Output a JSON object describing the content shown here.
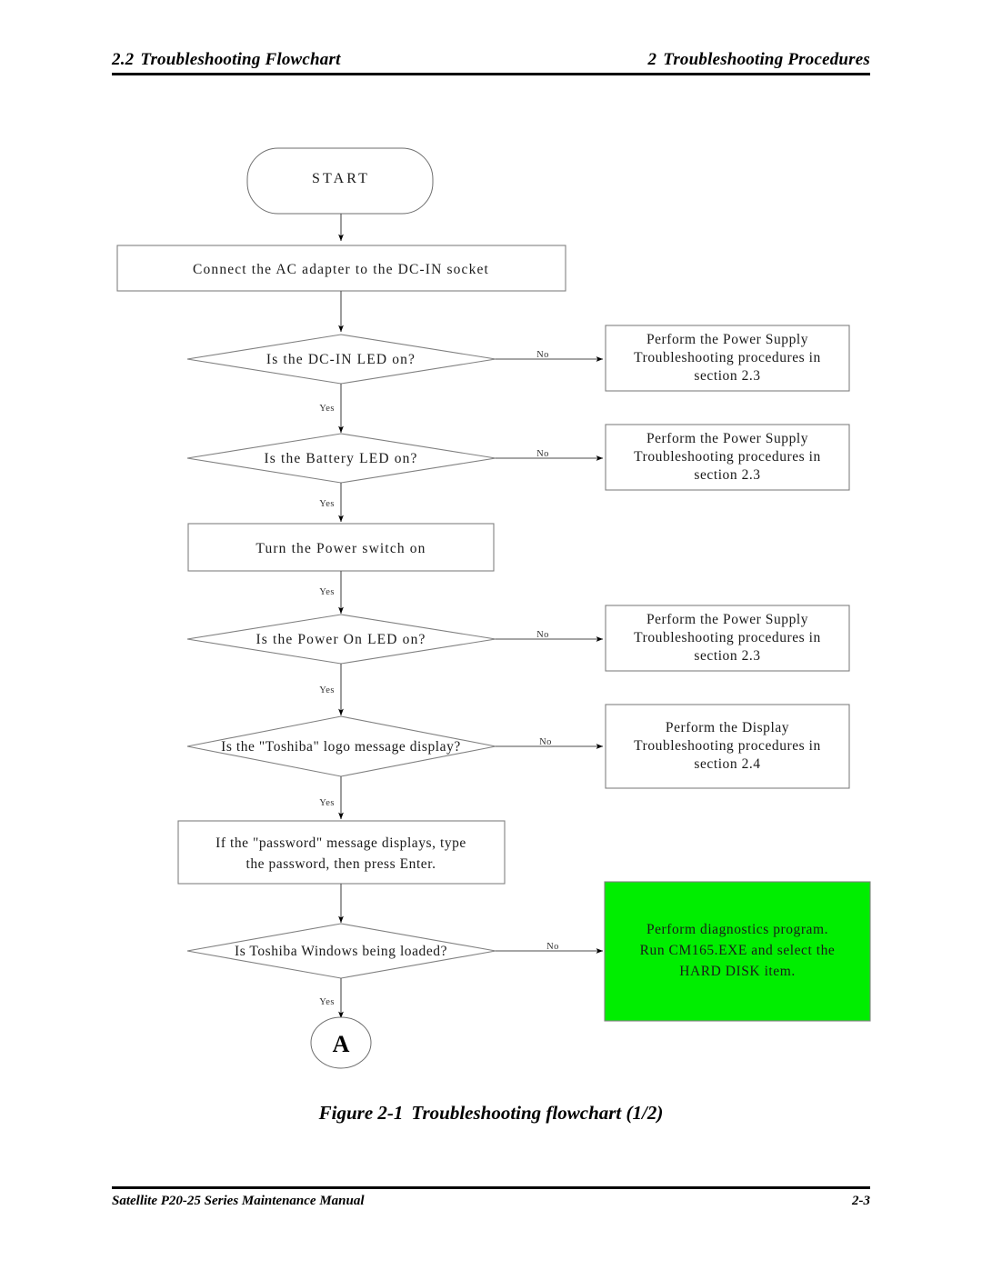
{
  "header": {
    "left_number": "2.2",
    "left_title": "Troubleshooting Flowchart",
    "right_number": "2",
    "right_title": "Troubleshooting Procedures"
  },
  "footer": {
    "manual_title": "Satellite P20-25 Series Maintenance Manual",
    "page_number": "2-3"
  },
  "caption": {
    "label": "Figure 2-1",
    "text": "Troubleshooting flowchart (1/2)"
  },
  "colors": {
    "highlight_green": "#00ee00",
    "shape_border": "#808080",
    "connector": "#4d4d4d",
    "text": "#1a1a1a"
  },
  "flowchart": {
    "branch_yes": "Yes",
    "branch_no": "No",
    "start": {
      "label": "START"
    },
    "connector_a": {
      "label": "A"
    },
    "steps": [
      {
        "id": "connect-ac-adapter",
        "type": "process",
        "text": "Connect the AC adapter to the DC-IN socket"
      },
      {
        "id": "dc-in-led",
        "type": "decision",
        "text": "Is the DC-IN LED on?"
      },
      {
        "id": "battery-led",
        "type": "decision",
        "text": "Is the Battery LED on?"
      },
      {
        "id": "turn-power-switch-on",
        "type": "process",
        "text": "Turn the Power switch on"
      },
      {
        "id": "power-on-led",
        "type": "decision",
        "text": "Is the Power On LED on?"
      },
      {
        "id": "toshiba-logo",
        "type": "decision",
        "text": "Is the \"Toshiba\" logo message display?"
      },
      {
        "id": "password-message",
        "type": "process",
        "line1": "If the \"password\" message displays, type",
        "line2": "the password, then press Enter."
      },
      {
        "id": "toshiba-windows-loaded",
        "type": "decision",
        "text": "Is Toshiba Windows being loaded?"
      }
    ],
    "outcomes": [
      {
        "id": "power-supply-1",
        "line1": "Perform the Power Supply",
        "line2": "Troubleshooting procedures in",
        "line3": "section 2.3",
        "highlight": false
      },
      {
        "id": "power-supply-2",
        "line1": "Perform the Power Supply",
        "line2": "Troubleshooting procedures in",
        "line3": "section 2.3",
        "highlight": false
      },
      {
        "id": "power-supply-3",
        "line1": "Perform the Power Supply",
        "line2": "Troubleshooting procedures in",
        "line3": "section 2.3",
        "highlight": false
      },
      {
        "id": "display-troubleshooting",
        "line1": "Perform the Display",
        "line2": "Troubleshooting procedures in",
        "line3": "section 2.4",
        "highlight": false
      },
      {
        "id": "diagnostics-hard-disk",
        "line1": "Perform diagnostics program.",
        "line2": "Run CM165.EXE and select the",
        "line3": "HARD DISK item.",
        "highlight": true
      }
    ]
  }
}
